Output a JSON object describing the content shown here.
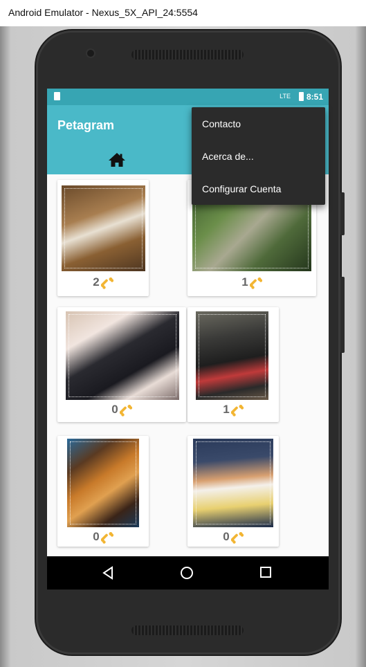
{
  "window": {
    "title": "Android Emulator - Nexus_5X_API_24:5554"
  },
  "status_bar": {
    "time": "8:51",
    "network": "LTE"
  },
  "app": {
    "title": "Petagram",
    "primary_color": "#4ab9c8",
    "status_color": "#37a5b3"
  },
  "tabs": [
    {
      "icon": "home-icon",
      "selected": true
    }
  ],
  "overflow_menu": {
    "items": [
      {
        "label": "Contacto"
      },
      {
        "label": "Acerca de..."
      },
      {
        "label": "Configurar Cuenta"
      }
    ]
  },
  "pets": [
    {
      "likes": "2",
      "icon": "bone-icon"
    },
    {
      "likes": "1",
      "icon": "bone-icon"
    },
    {
      "likes": "0",
      "icon": "bone-icon"
    },
    {
      "likes": "1",
      "icon": "bone-icon"
    },
    {
      "likes": "0",
      "icon": "bone-icon"
    },
    {
      "likes": "0",
      "icon": "bone-icon"
    }
  ],
  "nav_bar": {
    "back": "back-icon",
    "home": "home-circle-icon",
    "recents": "recents-icon"
  }
}
